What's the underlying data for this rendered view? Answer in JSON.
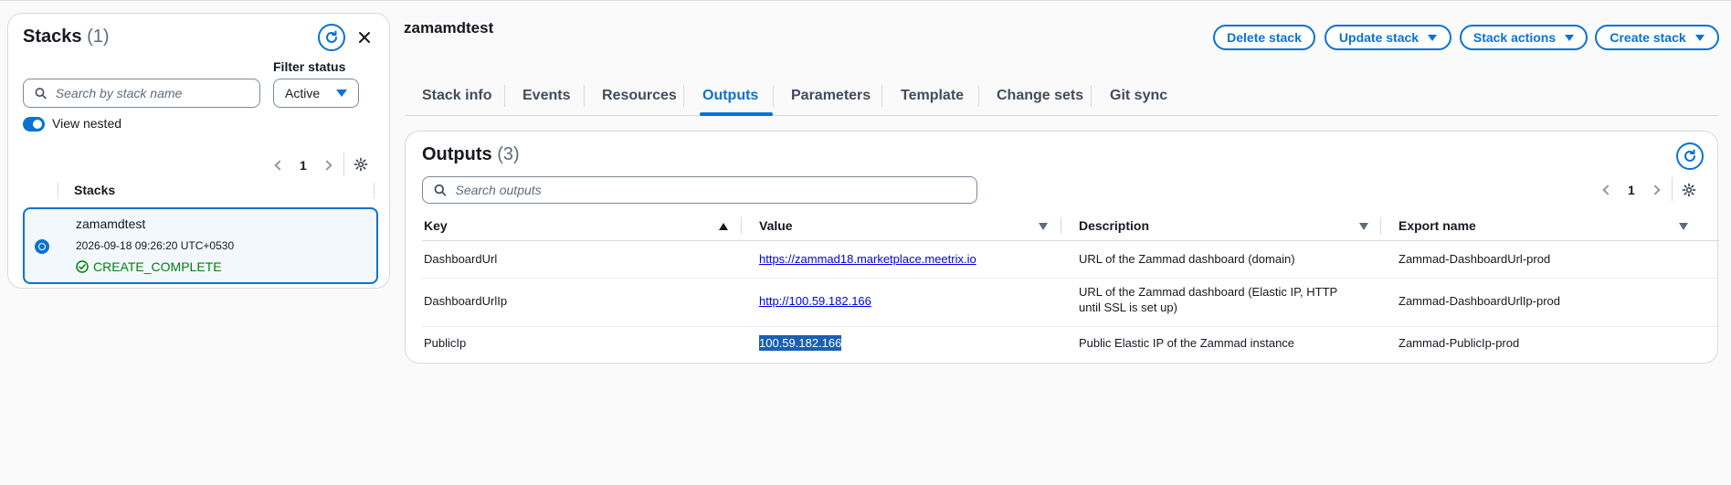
{
  "left": {
    "title": "Stacks",
    "count": "(1)",
    "search_placeholder": "Search by stack name",
    "filter_label": "Filter status",
    "filter_value": "Active",
    "view_nested_label": "View nested",
    "page": "1",
    "column_header": "Stacks",
    "stack": {
      "name": "zamamdtest",
      "time": "2026-09-18 09:26:20 UTC+0530",
      "status": "CREATE_COMPLETE"
    }
  },
  "header": {
    "stack_name": "zamamdtest",
    "buttons": {
      "delete": "Delete stack",
      "update": "Update stack",
      "actions": "Stack actions",
      "create": "Create stack"
    }
  },
  "tabs": [
    "Stack info",
    "Events",
    "Resources",
    "Outputs",
    "Parameters",
    "Template",
    "Change sets",
    "Git sync"
  ],
  "outputs": {
    "title": "Outputs",
    "count": "(3)",
    "search_placeholder": "Search outputs",
    "page": "1",
    "columns": [
      "Key",
      "Value",
      "Description",
      "Export name"
    ],
    "rows": [
      {
        "key": "DashboardUrl",
        "value": "https://zammad18.marketplace.meetrix.io",
        "description": "URL of the Zammad dashboard (domain)",
        "export": "Zammad-DashboardUrl-prod"
      },
      {
        "key": "DashboardUrlIp",
        "value": "http://100.59.182.166",
        "description": "URL of the Zammad dashboard (Elastic IP, HTTP until SSL is set up)",
        "export": "Zammad-DashboardUrlIp-prod"
      },
      {
        "key": "PublicIp",
        "value": "100.59.182.166",
        "description": "Public Elastic IP of the Zammad instance",
        "export": "Zammad-PublicIp-prod"
      }
    ]
  },
  "colors": {
    "accent": "#0972d3",
    "success": "#037f0c",
    "selection": "#1a5fb4"
  }
}
